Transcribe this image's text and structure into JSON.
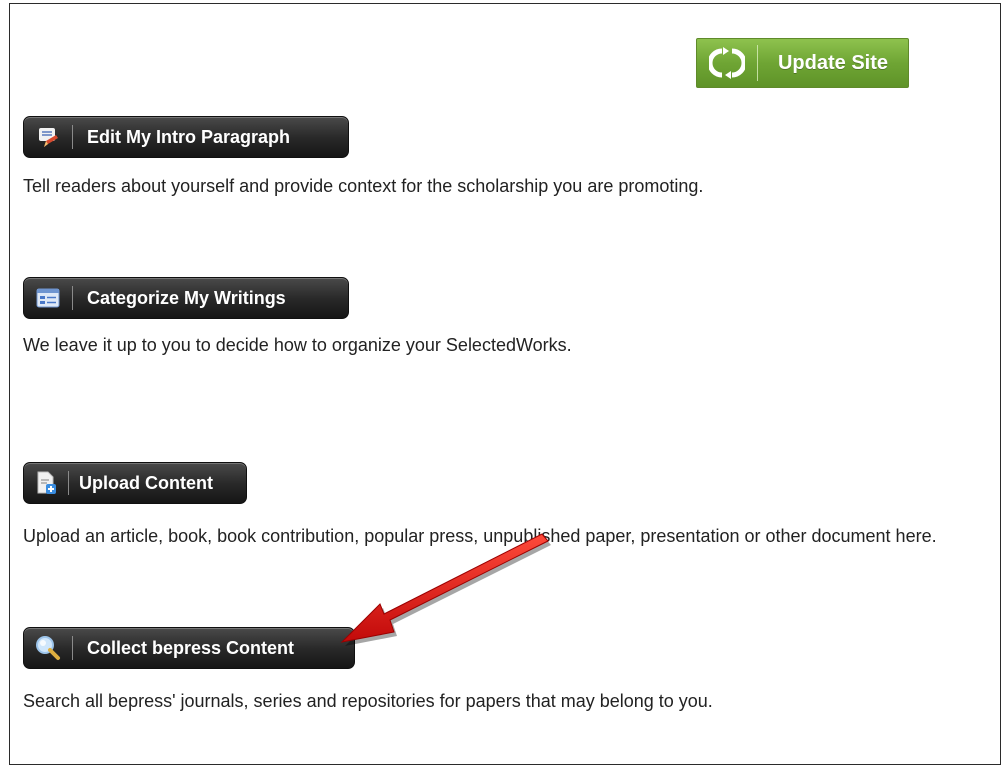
{
  "header": {
    "update_label": "Update Site"
  },
  "sections": [
    {
      "button_label": "Edit My Intro Paragraph",
      "icon": "edit-pencil-icon",
      "description": "Tell readers about yourself and provide context for the scholarship you are promoting."
    },
    {
      "button_label": "Categorize My Writings",
      "icon": "categories-icon",
      "description": "We leave it up to you to decide how to organize your SelectedWorks."
    },
    {
      "button_label": "Upload Content",
      "icon": "upload-document-icon",
      "description": "Upload an article, book, book contribution, popular press, unpublished paper, presentation or other document here."
    },
    {
      "button_label": "Collect bepress Content",
      "icon": "magnifier-icon",
      "description": "Search all bepress' journals, series and repositories for papers that may belong to you."
    }
  ],
  "colors": {
    "update_green": "#6fa534",
    "button_dark": "#2a2a2a",
    "arrow_red": "#e01010"
  }
}
